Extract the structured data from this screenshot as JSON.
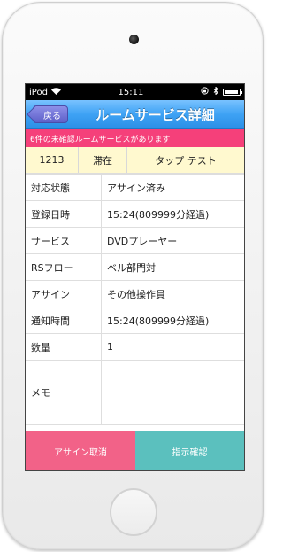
{
  "status_bar": {
    "carrier": "iPod",
    "time": "15:11"
  },
  "nav": {
    "back_label": "戻る",
    "title": "ルームサービス詳細"
  },
  "banner": {
    "text": "6件の未確認ルームサービスがあります"
  },
  "room": {
    "number": "1213",
    "status": "滞在",
    "guest": "タップ テスト"
  },
  "details": [
    {
      "label": "対応状態",
      "value": "アサイン済み"
    },
    {
      "label": "登録日時",
      "value": "15:24(809999分経過)"
    },
    {
      "label": "サービス",
      "value": "DVDプレーヤー"
    },
    {
      "label": "RSフロー",
      "value": "ベル部門対"
    },
    {
      "label": "アサイン",
      "value": "その他操作員"
    },
    {
      "label": "通知時間",
      "value": "15:24(809999分経過)"
    },
    {
      "label": "数量",
      "value": "1"
    },
    {
      "label": "メモ",
      "value": ""
    }
  ],
  "actions": {
    "cancel_assign": "アサイン取消",
    "confirm_instruction": "指示確認"
  },
  "colors": {
    "nav_blue": "#3ea2f4",
    "banner_pink": "#f5407a",
    "room_yellow": "#fff9cf",
    "cancel_pink": "#f26288",
    "confirm_teal": "#5bc0be"
  },
  "icons": {
    "wifi": "wifi-icon",
    "lock_rotation": "rotation-lock-icon",
    "bluetooth": "bluetooth-icon",
    "battery": "battery-icon"
  }
}
